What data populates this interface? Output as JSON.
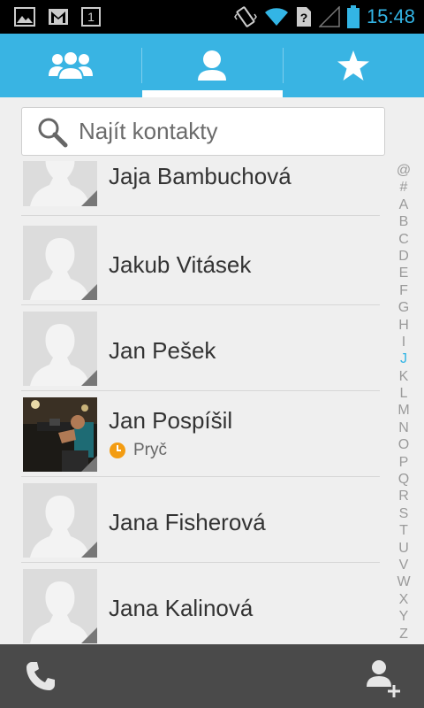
{
  "status_bar": {
    "time": "15:48",
    "notification_icons": [
      "image-icon",
      "gmail-icon",
      "calendar-icon"
    ],
    "calendar_day": "1",
    "system_icons": [
      "vibrate-icon",
      "wifi-icon",
      "no-sim-icon",
      "signal-icon",
      "battery-icon"
    ],
    "accent_color": "#33b5e5"
  },
  "tabs": [
    {
      "name": "groups",
      "icon": "groups-icon",
      "selected": false
    },
    {
      "name": "all-contacts",
      "icon": "person-icon",
      "selected": true
    },
    {
      "name": "favorites",
      "icon": "star-icon",
      "selected": false
    }
  ],
  "search": {
    "placeholder": "Najít kontakty",
    "value": ""
  },
  "contacts": [
    {
      "name": "Jaja Bambuchová",
      "avatar": "default-avatar"
    },
    {
      "name": "Jakub Vitásek",
      "avatar": "default-avatar"
    },
    {
      "name": "Jan Pešek",
      "avatar": "default-avatar"
    },
    {
      "name": "Jan Pospíšil",
      "avatar": "photo-avatar",
      "presence": "Pryč",
      "presence_icon": "clock-away-icon",
      "presence_color": "#f39c12"
    },
    {
      "name": "Jana Fisherová",
      "avatar": "default-avatar"
    },
    {
      "name": "Jana Kalinová",
      "avatar": "default-avatar"
    }
  ],
  "alphabet_index": {
    "letters": [
      "@",
      "#",
      "A",
      "B",
      "C",
      "D",
      "E",
      "F",
      "G",
      "H",
      "I",
      "J",
      "K",
      "L",
      "M",
      "N",
      "O",
      "P",
      "Q",
      "R",
      "S",
      "T",
      "U",
      "V",
      "W",
      "X",
      "Y",
      "Z"
    ],
    "active": "J"
  },
  "bottom_bar": {
    "left_icon": "phone-icon",
    "right_icon": "add-contact-icon"
  },
  "colors": {
    "tab_bar": "#39b4e3",
    "background": "#efefef",
    "bottom_bar": "#4a4a4a"
  }
}
